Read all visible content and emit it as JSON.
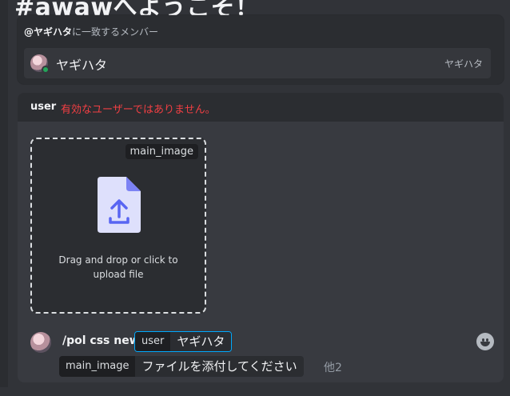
{
  "channel": {
    "heading": "#awawへようこそ！"
  },
  "mention_popup": {
    "query": "@ヤギハタ",
    "header_suffix": "に一致するメンバー",
    "member": {
      "display_name": "ヤギハタ",
      "username": "ヤギハタ",
      "status": "online",
      "status_color": "#23a559"
    }
  },
  "command_panel": {
    "error": {
      "option": "user",
      "message": "有効なユーザーではありません。",
      "color": "#f23f43"
    },
    "dropzone": {
      "tag": "main_image",
      "text_line1": "Drag and drop or click to",
      "text_line2": "upload file",
      "icon": "file-upload-icon"
    }
  },
  "composer": {
    "command": "/pol css new",
    "options": [
      {
        "name": "user",
        "value": "ヤギハタ",
        "focused": true
      },
      {
        "name": "main_image",
        "value": "ファイルを添付してください",
        "focused": false
      }
    ],
    "more_label": "他2",
    "emoji_icon": "emoji-smile-icon",
    "accent": "#00a8fc"
  }
}
